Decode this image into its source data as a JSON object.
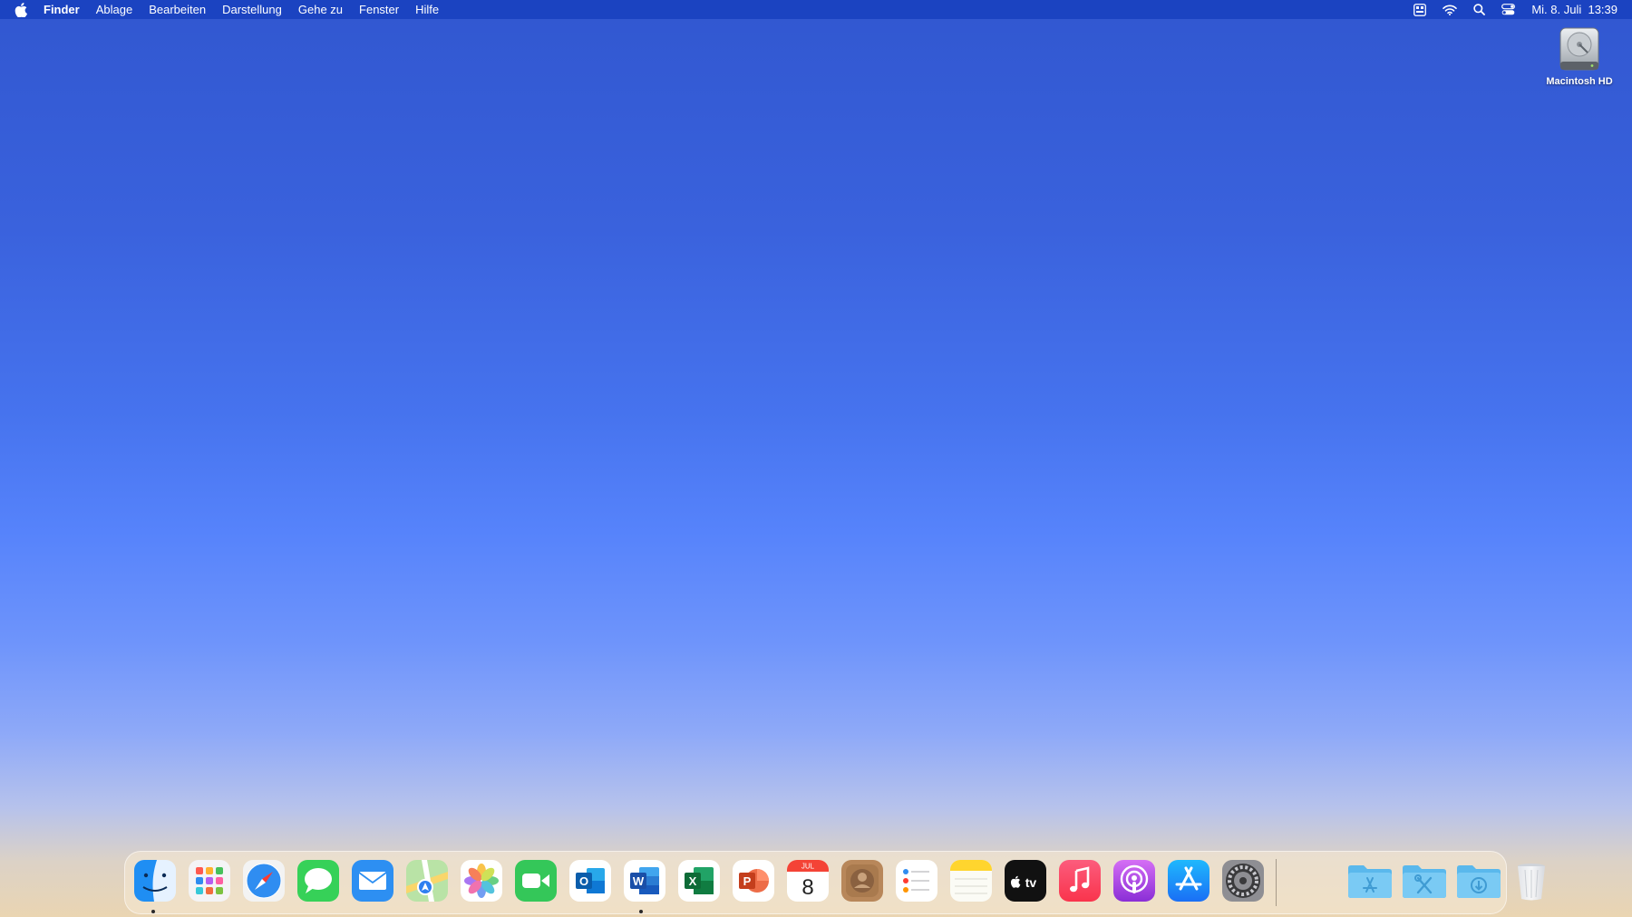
{
  "menubar": {
    "apple_icon": "apple-logo-icon",
    "items": [
      {
        "label": "Finder",
        "bold": true
      },
      {
        "label": "Ablage"
      },
      {
        "label": "Bearbeiten"
      },
      {
        "label": "Darstellung"
      },
      {
        "label": "Gehe zu"
      },
      {
        "label": "Fenster"
      },
      {
        "label": "Hilfe"
      }
    ],
    "status_icons": [
      "keyboard-input-icon",
      "wifi-icon",
      "spotlight-search-icon",
      "control-center-icon"
    ],
    "clock": "Mi. 8. Juli  13:39"
  },
  "desktop": {
    "icons": [
      {
        "label": "Macintosh HD",
        "icon": "hard-drive-icon"
      }
    ]
  },
  "dock": {
    "apps": [
      {
        "name": "Finder",
        "icon": "finder-icon",
        "running": true
      },
      {
        "name": "Launchpad",
        "icon": "launchpad-icon"
      },
      {
        "name": "Safari",
        "icon": "safari-icon"
      },
      {
        "name": "Nachrichten",
        "icon": "messages-icon"
      },
      {
        "name": "Mail",
        "icon": "mail-icon"
      },
      {
        "name": "Karten",
        "icon": "maps-icon"
      },
      {
        "name": "Fotos",
        "icon": "photos-icon"
      },
      {
        "name": "FaceTime",
        "icon": "facetime-icon"
      },
      {
        "name": "Microsoft Outlook",
        "icon": "outlook-icon"
      },
      {
        "name": "Microsoft Word",
        "icon": "word-icon",
        "running": true
      },
      {
        "name": "Microsoft Excel",
        "icon": "excel-icon"
      },
      {
        "name": "Microsoft PowerPoint",
        "icon": "powerpoint-icon"
      },
      {
        "name": "Kalender",
        "icon": "calendar-icon",
        "month": "JUL",
        "day": "8"
      },
      {
        "name": "Kontakte",
        "icon": "contacts-icon"
      },
      {
        "name": "Erinnerungen",
        "icon": "reminders-icon"
      },
      {
        "name": "Notizen",
        "icon": "notes-icon"
      },
      {
        "name": "TV",
        "icon": "apple-tv-icon",
        "glyph": "tv"
      },
      {
        "name": "Musik",
        "icon": "music-icon"
      },
      {
        "name": "Podcasts",
        "icon": "podcasts-icon"
      },
      {
        "name": "App Store",
        "icon": "app-store-icon"
      },
      {
        "name": "Systemeinstellungen",
        "icon": "system-preferences-icon"
      }
    ],
    "folders": [
      {
        "name": "Programme",
        "icon": "applications-folder-icon"
      },
      {
        "name": "Dienstprogramme",
        "icon": "utilities-folder-icon"
      },
      {
        "name": "Downloads",
        "icon": "downloads-folder-icon"
      },
      {
        "name": "Papierkorb",
        "icon": "trash-icon"
      }
    ]
  },
  "colors": {
    "menubar": "#1840be",
    "dock_background": "#f5e8d2",
    "wallpaper_top": "#3157d0",
    "wallpaper_middle": "#5683fb",
    "wallpaper_bottom": "#ead5b2"
  }
}
